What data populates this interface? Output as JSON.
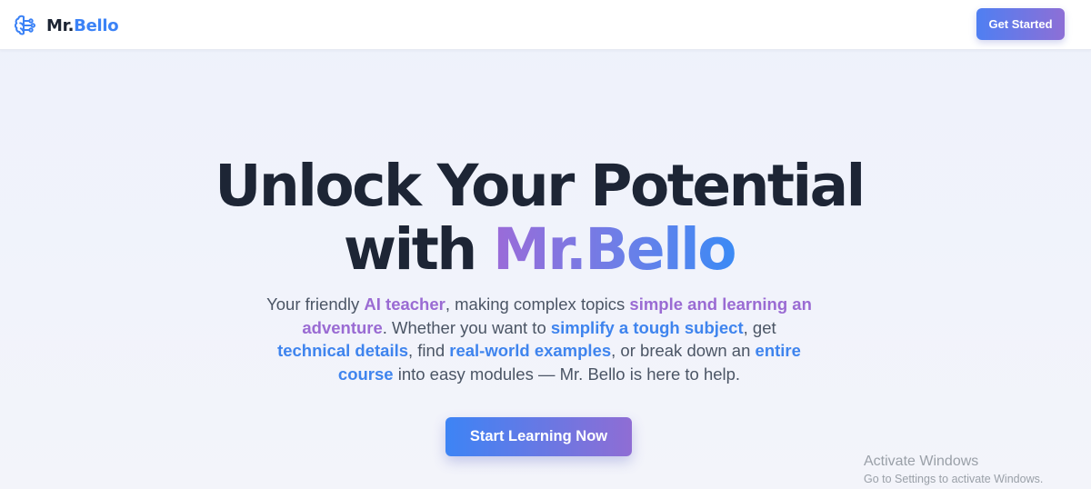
{
  "header": {
    "logo_icon": "brain-icon",
    "brand_prefix": "Mr.",
    "brand_suffix": "Bello",
    "cta_label": "Get Started"
  },
  "hero": {
    "title_line1": "Unlock Your Potential",
    "title_line2_prefix": "with ",
    "title_line2_highlight": "Mr.Bello",
    "description": {
      "t1": "Your friendly ",
      "h1": "AI teacher",
      "t2": ", making complex topics ",
      "h2": "simple and learning an adventure",
      "t3": ". Whether you want to ",
      "h3": "simplify a tough subject",
      "t4": ", get ",
      "h4": "technical details",
      "t5": ", find ",
      "h5": "real-world examples",
      "t6": ", or break down an ",
      "h6": "entire course",
      "t7": " into easy modules — Mr. Bello is here to help."
    },
    "cta_label": "Start Learning Now"
  },
  "watermark": {
    "title": "Activate Windows",
    "subtitle": "Go to Settings to activate Windows."
  },
  "colors": {
    "accent_blue": "#3b82f6",
    "accent_purple": "#9a6bd3",
    "heading": "#1d2535",
    "body_text": "#4b5565"
  }
}
